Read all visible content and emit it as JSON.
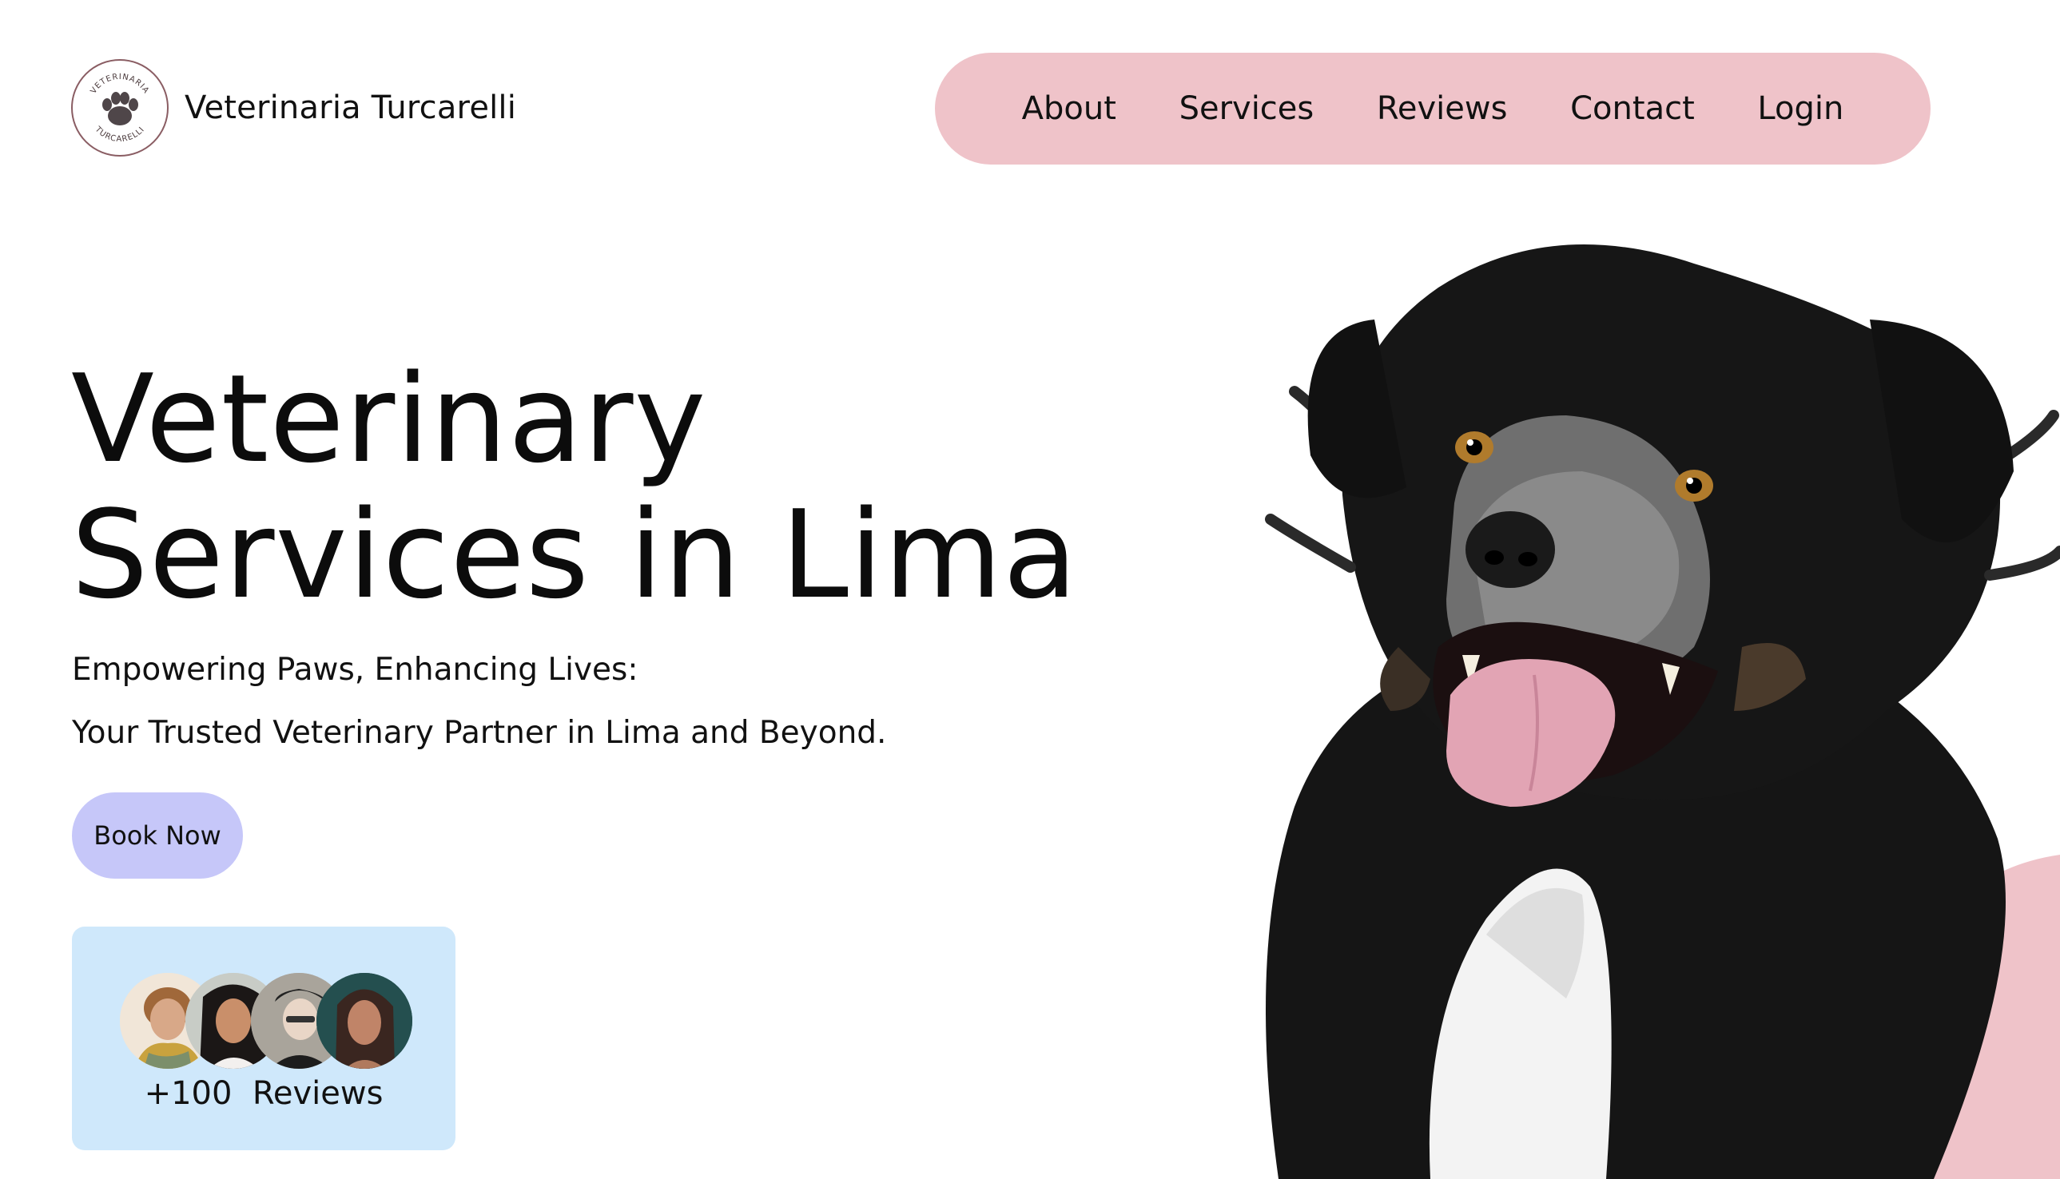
{
  "brand": {
    "name": "Veterinaria Turcarelli",
    "logo_icon": "paw-print-seal-icon",
    "logo_text_top": "VETERINARIA",
    "logo_text_bottom": "TURCARELLI"
  },
  "nav": {
    "items": [
      {
        "label": "About"
      },
      {
        "label": "Services"
      },
      {
        "label": "Reviews"
      },
      {
        "label": "Contact"
      },
      {
        "label": "Login"
      }
    ]
  },
  "hero": {
    "headline_line1": "Veterinary",
    "headline_line2": "Services in Lima",
    "subtitle_line1": "Empowering Paws, Enhancing Lives:",
    "subtitle_line2": "Your Trusted Veterinary Partner in Lima and Beyond.",
    "cta_label": "Book Now"
  },
  "reviews": {
    "count": "+100",
    "label": "Reviews",
    "avatar_count": 4
  },
  "colors": {
    "nav_bg": "#efc3c9",
    "cta_bg": "#c6c7f9",
    "card_bg": "#cfe8fb",
    "blob": "#efc3c9"
  },
  "icons": {
    "hero_image": "dog-photo"
  }
}
